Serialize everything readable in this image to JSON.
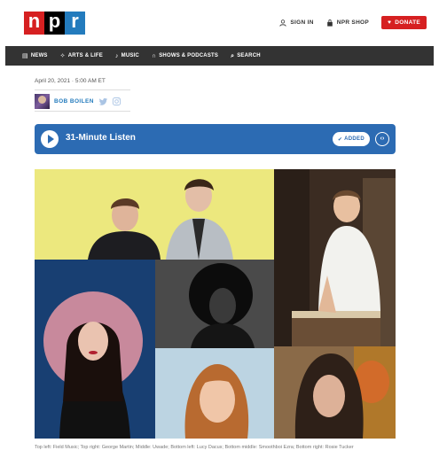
{
  "brand": {
    "letters": [
      "n",
      "p",
      "r"
    ],
    "colors": {
      "n": "#d62021",
      "p": "#000000",
      "r": "#237bbd"
    }
  },
  "header": {
    "sign_in": "SIGN IN",
    "shop": "NPR SHOP",
    "donate": "DONATE"
  },
  "nav": {
    "items": [
      {
        "label": "NEWS",
        "icon": "newspaper-icon"
      },
      {
        "label": "ARTS & LIFE",
        "icon": "arts-icon"
      },
      {
        "label": "MUSIC",
        "icon": "music-note-icon"
      },
      {
        "label": "SHOWS & PODCASTS",
        "icon": "headphones-icon"
      },
      {
        "label": "SEARCH",
        "icon": "search-icon"
      }
    ]
  },
  "article": {
    "date": "April 20, 2021 · 5:00 AM ET",
    "author": "BOB BOILEN"
  },
  "player": {
    "title": "31-Minute Listen",
    "added_label": "ADDED",
    "accent": "#2c6bb3"
  },
  "image": {
    "caption": "Top left: Field Music; Top right: George Martin; Middle: Uwade; Bottom left: Lucy Dacus; Bottom middle: Smoothboi Ezra; Bottom right: Rosie Tucker"
  }
}
